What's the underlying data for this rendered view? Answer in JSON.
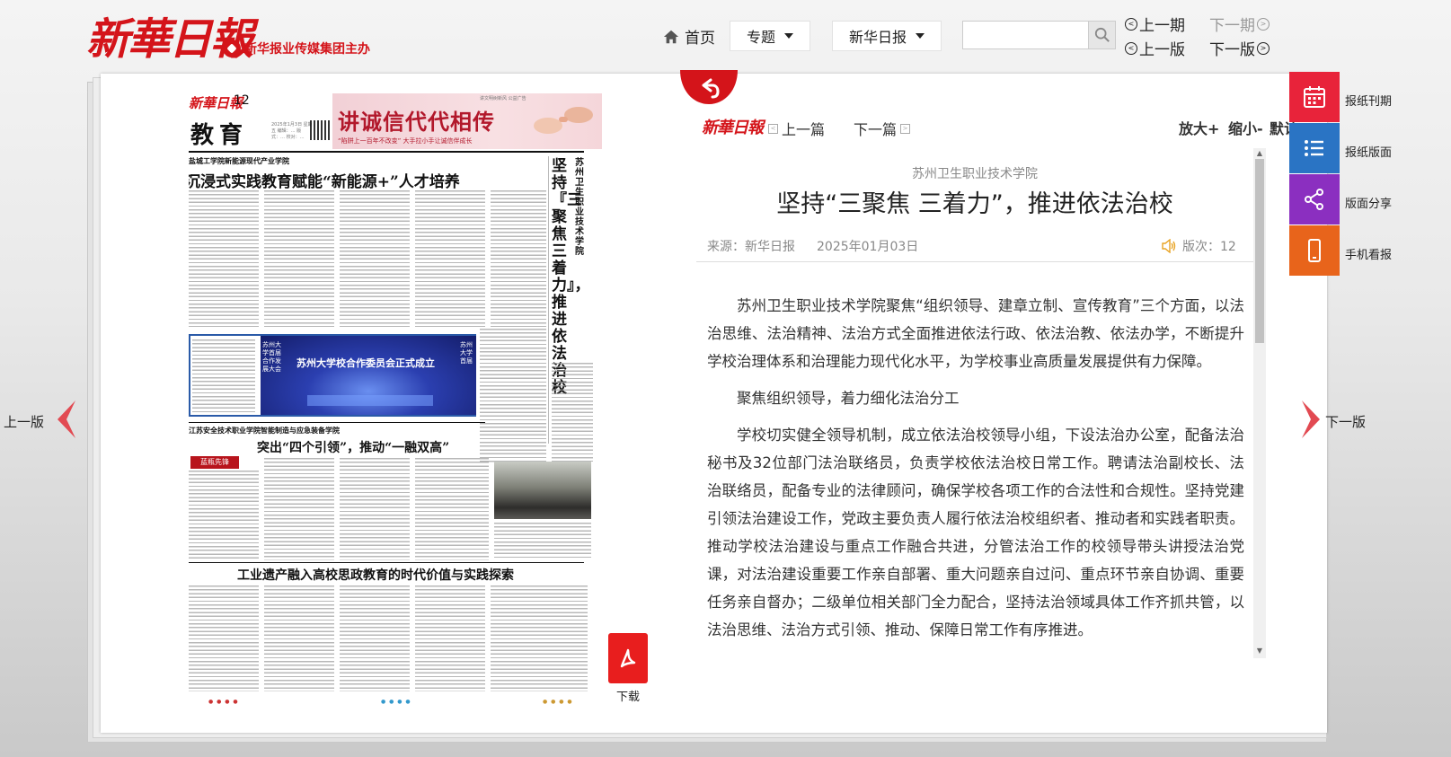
{
  "header": {
    "logo": "新華日報",
    "sublogo": "新华报业传媒集团主办",
    "nav_home": "首页",
    "dropdown_topic": "专题",
    "dropdown_paper": "新华日报",
    "search_placeholder": "",
    "prev_issue": "上一期",
    "next_issue": "下一期",
    "prev_page": "上一版",
    "next_page": "下一版"
  },
  "newspaper": {
    "logo": "新華日報",
    "page_number": "12",
    "section": "教育",
    "date_block": "2025年1月3日 星期五 编辑：… 版式：… 校对：…",
    "tag": "讲文明树新风 公益广告",
    "ad_title": "讲诚信代代相传",
    "ad_sub": "“陷阱上一百年不改变” 大手拉小手让诚信伴成长",
    "story1_kicker": "盐城工学院新能源现代产业学院",
    "story1_headline": "沉浸式实践教育赋能“新能源+”人才培养",
    "vertical_kicker": "苏州卫生职业技术学院",
    "vertical_headline": "坚持『三聚焦 三着力』，推进依法治校",
    "photo1_caption": "苏州大学校合作委员会正式成立",
    "photo1_side_left": "苏州大学首届合作发展大会",
    "photo1_side_right": "苏州大学首届",
    "story2_kicker": "江苏安全技术职业学院智能制造与应急装备学院",
    "story2_headline": "突出“四个引领”，推动“一融双高”",
    "brand_chip": "蓝瓶先锋",
    "story3_headline": "工业遗产融入高校思政教育的时代价值与实践探索"
  },
  "download_label": "下载",
  "article": {
    "logo": "新華日報",
    "prev": "上一篇",
    "next": "下一篇",
    "zoom_in": "放大+",
    "zoom_out": "缩小-",
    "zoom_default": "默认",
    "kicker": "苏州卫生职业技术学院",
    "title": "坚持“三聚焦 三着力”，推进依法治校",
    "source": "来源：新华日报",
    "date": "2025年01月03日",
    "issue": "版次：12",
    "paragraphs": [
      "苏州卫生职业技术学院聚焦“组织领导、建章立制、宣传教育”三个方面，以法治思维、法治精神、法治方式全面推进依法行政、依法治教、依法办学，不断提升学校治理体系和治理能力现代化水平，为学校事业高质量发展提供有力保障。",
      "聚焦组织领导，着力细化法治分工",
      "学校切实健全领导机制，成立依法治校领导小组，下设法治办公室，配备法治秘书及32位部门法治联络员，负责学校依法治校日常工作。聘请法治副校长、法治联络员，配备专业的法律顾问，确保学校各项工作的合法性和合规性。坚持党建引领法治建设工作，党政主要负责人履行依法治校组织者、推动者和实践者职责。推动学校法治建设与重点工作融合共进，分管法治工作的校领导带头讲授法治党课，对法治建设重要工作亲自部署、重大问题亲自过问、重点环节亲自协调、重要任务亲自督办；二级单位相关部门全力配合，坚持法治领域具体工作齐抓共管，以法治思维、法治方式引领、推动、保障日常工作有序推进。"
    ]
  },
  "side": {
    "prev_page": "上一版",
    "next_page": "下一版"
  },
  "rail": [
    {
      "label": "报纸刊期",
      "icon": "calendar-icon",
      "color": "#e8233a"
    },
    {
      "label": "报纸版面",
      "icon": "list-icon",
      "color": "#2a74c4"
    },
    {
      "label": "版面分享",
      "icon": "share-icon",
      "color": "#8b2fc0"
    },
    {
      "label": "手机看报",
      "icon": "phone-icon",
      "color": "#e8641b"
    }
  ],
  "colors": {
    "brand_red": "#d4141a",
    "text": "#333333",
    "muted": "#888888"
  }
}
